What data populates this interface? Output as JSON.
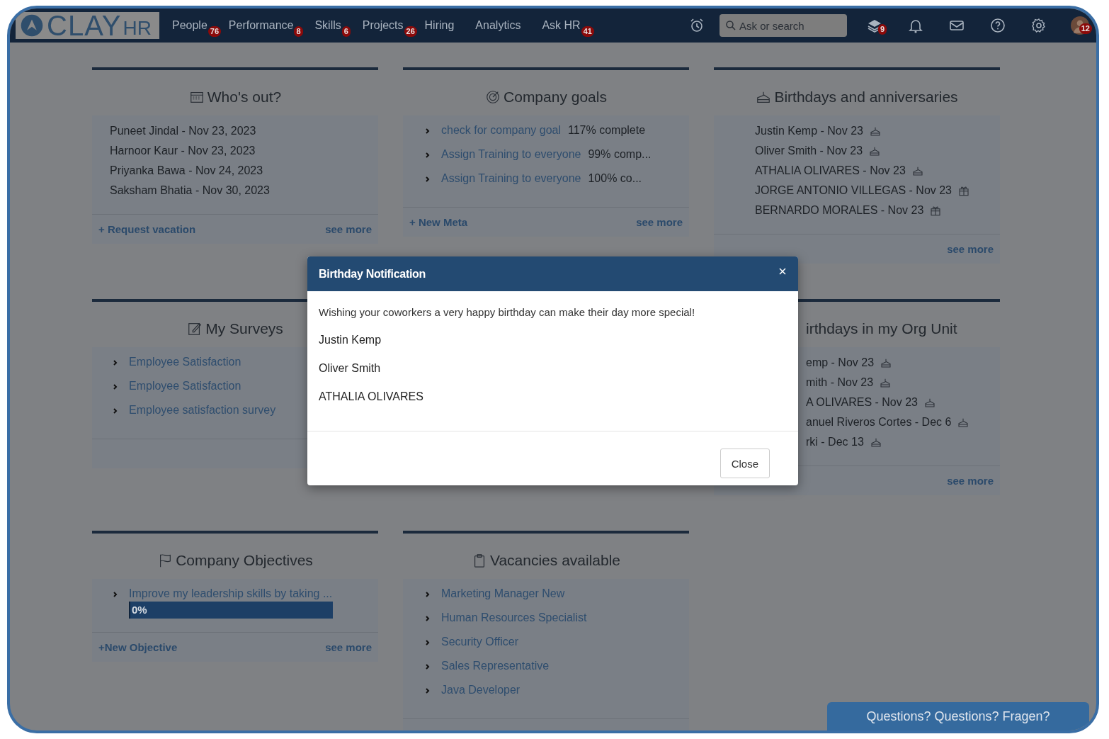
{
  "brand": {
    "name": "CLAY",
    "suffix": "HR"
  },
  "nav": [
    {
      "label": "People",
      "badge": "76"
    },
    {
      "label": "Performance",
      "badge": "8"
    },
    {
      "label": "Skills",
      "badge": "6"
    },
    {
      "label": "Projects",
      "badge": "26"
    },
    {
      "label": "Hiring"
    },
    {
      "label": "Analytics"
    },
    {
      "label": "Ask HR",
      "badge": "41"
    }
  ],
  "search": {
    "placeholder": "Ask or search"
  },
  "toolbar": [
    {
      "kind": "layers",
      "badge": "9"
    },
    {
      "kind": "bell"
    },
    {
      "kind": "mail"
    },
    {
      "kind": "help"
    },
    {
      "kind": "settings"
    },
    {
      "kind": "avatar",
      "badge": "12"
    }
  ],
  "cards": [
    {
      "kind": "absences",
      "title": "Who's out?",
      "items": [
        {
          "text": "Puneet Jindal - Nov 23, 2023"
        },
        {
          "text": "Harnoor Kaur - Nov 23, 2023"
        },
        {
          "text": "Priyanka Bawa - Nov 24, 2023"
        },
        {
          "text": "Saksham Bhatia - Nov 30, 2023"
        }
      ],
      "action": "+ Request vacation",
      "more": "see more"
    },
    {
      "kind": "goals",
      "title": "Company goals",
      "items": [
        {
          "link": "check for company goal",
          "status": "117% complete"
        },
        {
          "link": "Assign Training to everyone",
          "status": "99% comp..."
        },
        {
          "link": "Assign Training to everyone",
          "status": "100% co..."
        }
      ],
      "action": "+ New Meta",
      "more": "see more"
    },
    {
      "kind": "birthdays",
      "title": "Birthdays and anniversaries",
      "items": [
        {
          "text": "Justin Kemp - Nov 23",
          "kind": "birthday"
        },
        {
          "text": "Oliver Smith - Nov 23",
          "kind": "birthday"
        },
        {
          "text": "ATHALIA OLIVARES - Nov 23",
          "kind": "birthday"
        },
        {
          "text": "JORGE ANTONIO VILLEGAS - Nov 23",
          "kind": "anniversary"
        },
        {
          "text": "BERNARDO MORALES - Nov 23",
          "kind": "anniversary"
        }
      ],
      "more": "see more"
    },
    {
      "kind": "surveys",
      "title": "My Surveys",
      "items": [
        {
          "link": "Employee Satisfaction"
        },
        {
          "link": "Employee Satisfaction"
        },
        {
          "link": "Employee satisfaction survey"
        }
      ]
    },
    {
      "kind": "org_birthdays",
      "title": "irthdays in my Org Unit",
      "items": [
        {
          "text": "emp - Nov 23",
          "kind": "birthday"
        },
        {
          "text": "mith - Nov 23",
          "kind": "birthday"
        },
        {
          "text": "A OLIVARES - Nov 23",
          "kind": "birthday"
        },
        {
          "text": "anuel Riveros Cortes - Dec 6",
          "kind": "birthday"
        },
        {
          "text": "rki - Dec 13",
          "kind": "birthday"
        }
      ],
      "more": "see more"
    },
    {
      "kind": "objectives",
      "title": "Company Objectives",
      "items": [
        {
          "link": "Improve my leadership skills by taking ...",
          "level": 0,
          "progress": "0%"
        }
      ],
      "action": "+New Objective",
      "more": "see more"
    },
    {
      "kind": "vacancies",
      "title": "Vacancies available",
      "items": [
        {
          "link": "Marketing Manager New"
        },
        {
          "link": "Human Resources Specialist"
        },
        {
          "link": "Security Officer"
        },
        {
          "link": "Sales Representative"
        },
        {
          "link": "Java Developer"
        }
      ]
    }
  ],
  "modal": {
    "title": "Birthday Notification",
    "message": "Wishing your coworkers a very happy birthday can make their day more special!",
    "names": [
      "Justin Kemp",
      "Oliver Smith",
      "ATHALIA OLIVARES"
    ],
    "button": "Close"
  },
  "help_bar": "Questions? Questions? Fragen?"
}
